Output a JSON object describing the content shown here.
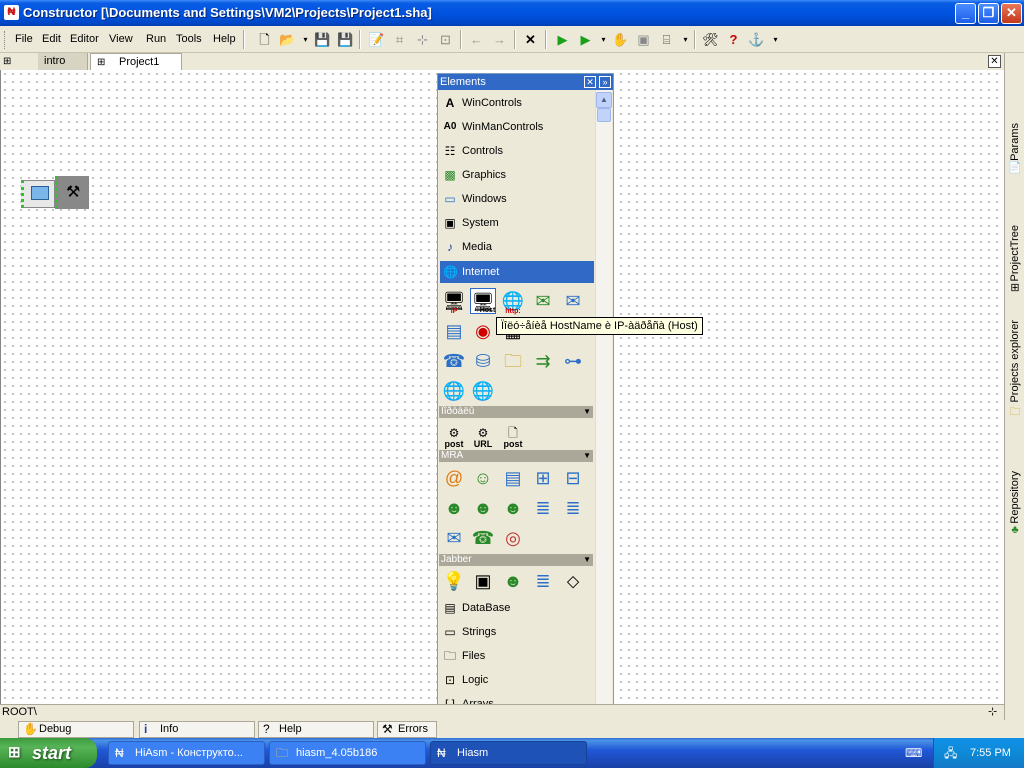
{
  "window": {
    "title": "Constructor [\\Documents and Settings\\VM2\\Projects\\Project1.sha]",
    "app_icon": "hiasm-icon",
    "buttons": {
      "minimize": "minimize-icon",
      "restore": "restore-icon",
      "close": "close-icon"
    }
  },
  "menu": [
    "File",
    "Edit",
    "Editor",
    "View",
    "Run",
    "Tools",
    "Help"
  ],
  "tabs": {
    "intro": "intro",
    "project": "Project1"
  },
  "panel": {
    "title": "Elements",
    "categories": [
      {
        "label": "WinControls",
        "icon": "A"
      },
      {
        "label": "WinManControls",
        "icon": "A0"
      },
      {
        "label": "Controls",
        "icon": "controls-icon"
      },
      {
        "label": "Graphics",
        "icon": "graphics-icon"
      },
      {
        "label": "Windows",
        "icon": "windows-icon"
      },
      {
        "label": "System",
        "icon": "system-icon"
      },
      {
        "label": "Media",
        "icon": "media-icon"
      },
      {
        "label": "Internet",
        "icon": "internet-icon",
        "selected": true
      }
    ],
    "internet_icon_labels": {
      "ip": "IP",
      "host": "→Host",
      "http": "http:"
    },
    "groups": {
      "g1": "Ïîðòàëû",
      "g1_items": [
        "post",
        "URL",
        "post"
      ],
      "mra": "MRA",
      "jabber": "Jabber"
    },
    "categories_after": [
      {
        "label": "DataBase",
        "icon": "database-icon"
      },
      {
        "label": "Strings",
        "icon": "strings-icon"
      },
      {
        "label": "Files",
        "icon": "files-icon"
      },
      {
        "label": "Logic",
        "icon": "logic-icon"
      },
      {
        "label": "Arrays",
        "icon": "[ ]"
      }
    ]
  },
  "tooltip": "Ïîëó÷åíèå HostName è IP-àäðåñà (Host)",
  "right_dock": [
    "Params",
    "ProjectTree",
    "Projects explorer",
    "Repository"
  ],
  "status": {
    "path": "ROOT\\"
  },
  "bottom_tabs": [
    "Debug",
    "Info",
    "Help",
    "Errors"
  ],
  "taskbar": {
    "start": "start",
    "tasks": [
      "HiAsm - Конструкто...",
      "hiasm_4.05b186",
      "Hiasm"
    ],
    "clock": "7:55 PM"
  },
  "colors": {
    "selection": "#3169c6",
    "panel": "#ece9d8",
    "tooltip_bg": "#ffffe1"
  }
}
